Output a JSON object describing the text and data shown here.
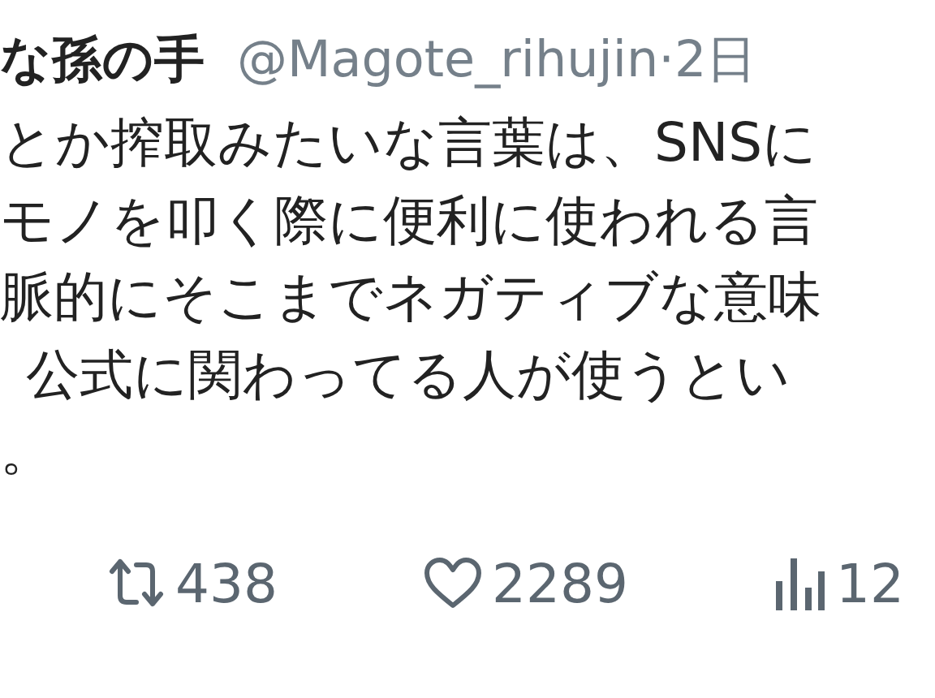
{
  "tweet": {
    "author_name": "な孫の手",
    "handle": "@Magote_rihujin",
    "separator": "·",
    "time": "2日",
    "body_lines": [
      "とか搾取みたいな言葉は、SNSに",
      "モノを叩く際に便利に使われる言",
      "脈的にそこまでネガティブな意味",
      "公式に関わってる人が使うとい",
      "。"
    ],
    "actions": [
      {
        "kind": "retweet",
        "count": "438"
      },
      {
        "kind": "like",
        "count": "2289"
      },
      {
        "kind": "views",
        "count": "12"
      }
    ]
  }
}
